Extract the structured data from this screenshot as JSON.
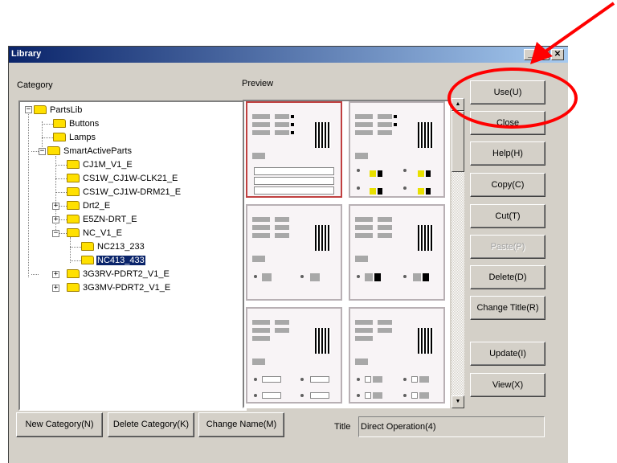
{
  "window": {
    "title": "Library",
    "controls": {
      "minimize": "_",
      "maximize": "□",
      "close": "✕"
    }
  },
  "category_label": "Category",
  "preview_label": "Preview",
  "tree": {
    "nodes": [
      {
        "label": "PartsLib"
      },
      {
        "label": "Buttons"
      },
      {
        "label": "Lamps"
      },
      {
        "label": "SmartActiveParts"
      },
      {
        "label": "CJ1M_V1_E"
      },
      {
        "label": "CS1W_CJ1W-CLK21_E"
      },
      {
        "label": "CS1W_CJ1W-DRM21_E"
      },
      {
        "label": "Drt2_E"
      },
      {
        "label": "E5ZN-DRT_E"
      },
      {
        "label": "NC_V1_E"
      },
      {
        "label": "NC213_233"
      },
      {
        "label": "NC413_433"
      },
      {
        "label": "3G3RV-PDRT2_V1_E"
      },
      {
        "label": "3G3MV-PDRT2_V1_E"
      }
    ],
    "selected": "NC413_433"
  },
  "buttons": {
    "use": "Use(U)",
    "close": "Close",
    "help": "Help(H)",
    "copy": "Copy(C)",
    "cut": "Cut(T)",
    "paste": "Paste(P)",
    "delete": "Delete(D)",
    "change_title": "Change Title(R)",
    "update": "Update(I)",
    "view": "View(X)",
    "new_category": "New Category(N)",
    "delete_category": "Delete Category(K)",
    "change_name": "Change Name(M)"
  },
  "title_field": {
    "label": "Title",
    "value": "Direct Operation(4)"
  },
  "annotation": {
    "color": "#ff0000"
  },
  "colors": {
    "titlebar_start": "#0a246a",
    "titlebar_end": "#a6caf0",
    "face": "#d4d0c8",
    "selection": "#0a246a",
    "folder": "#ffe000"
  }
}
